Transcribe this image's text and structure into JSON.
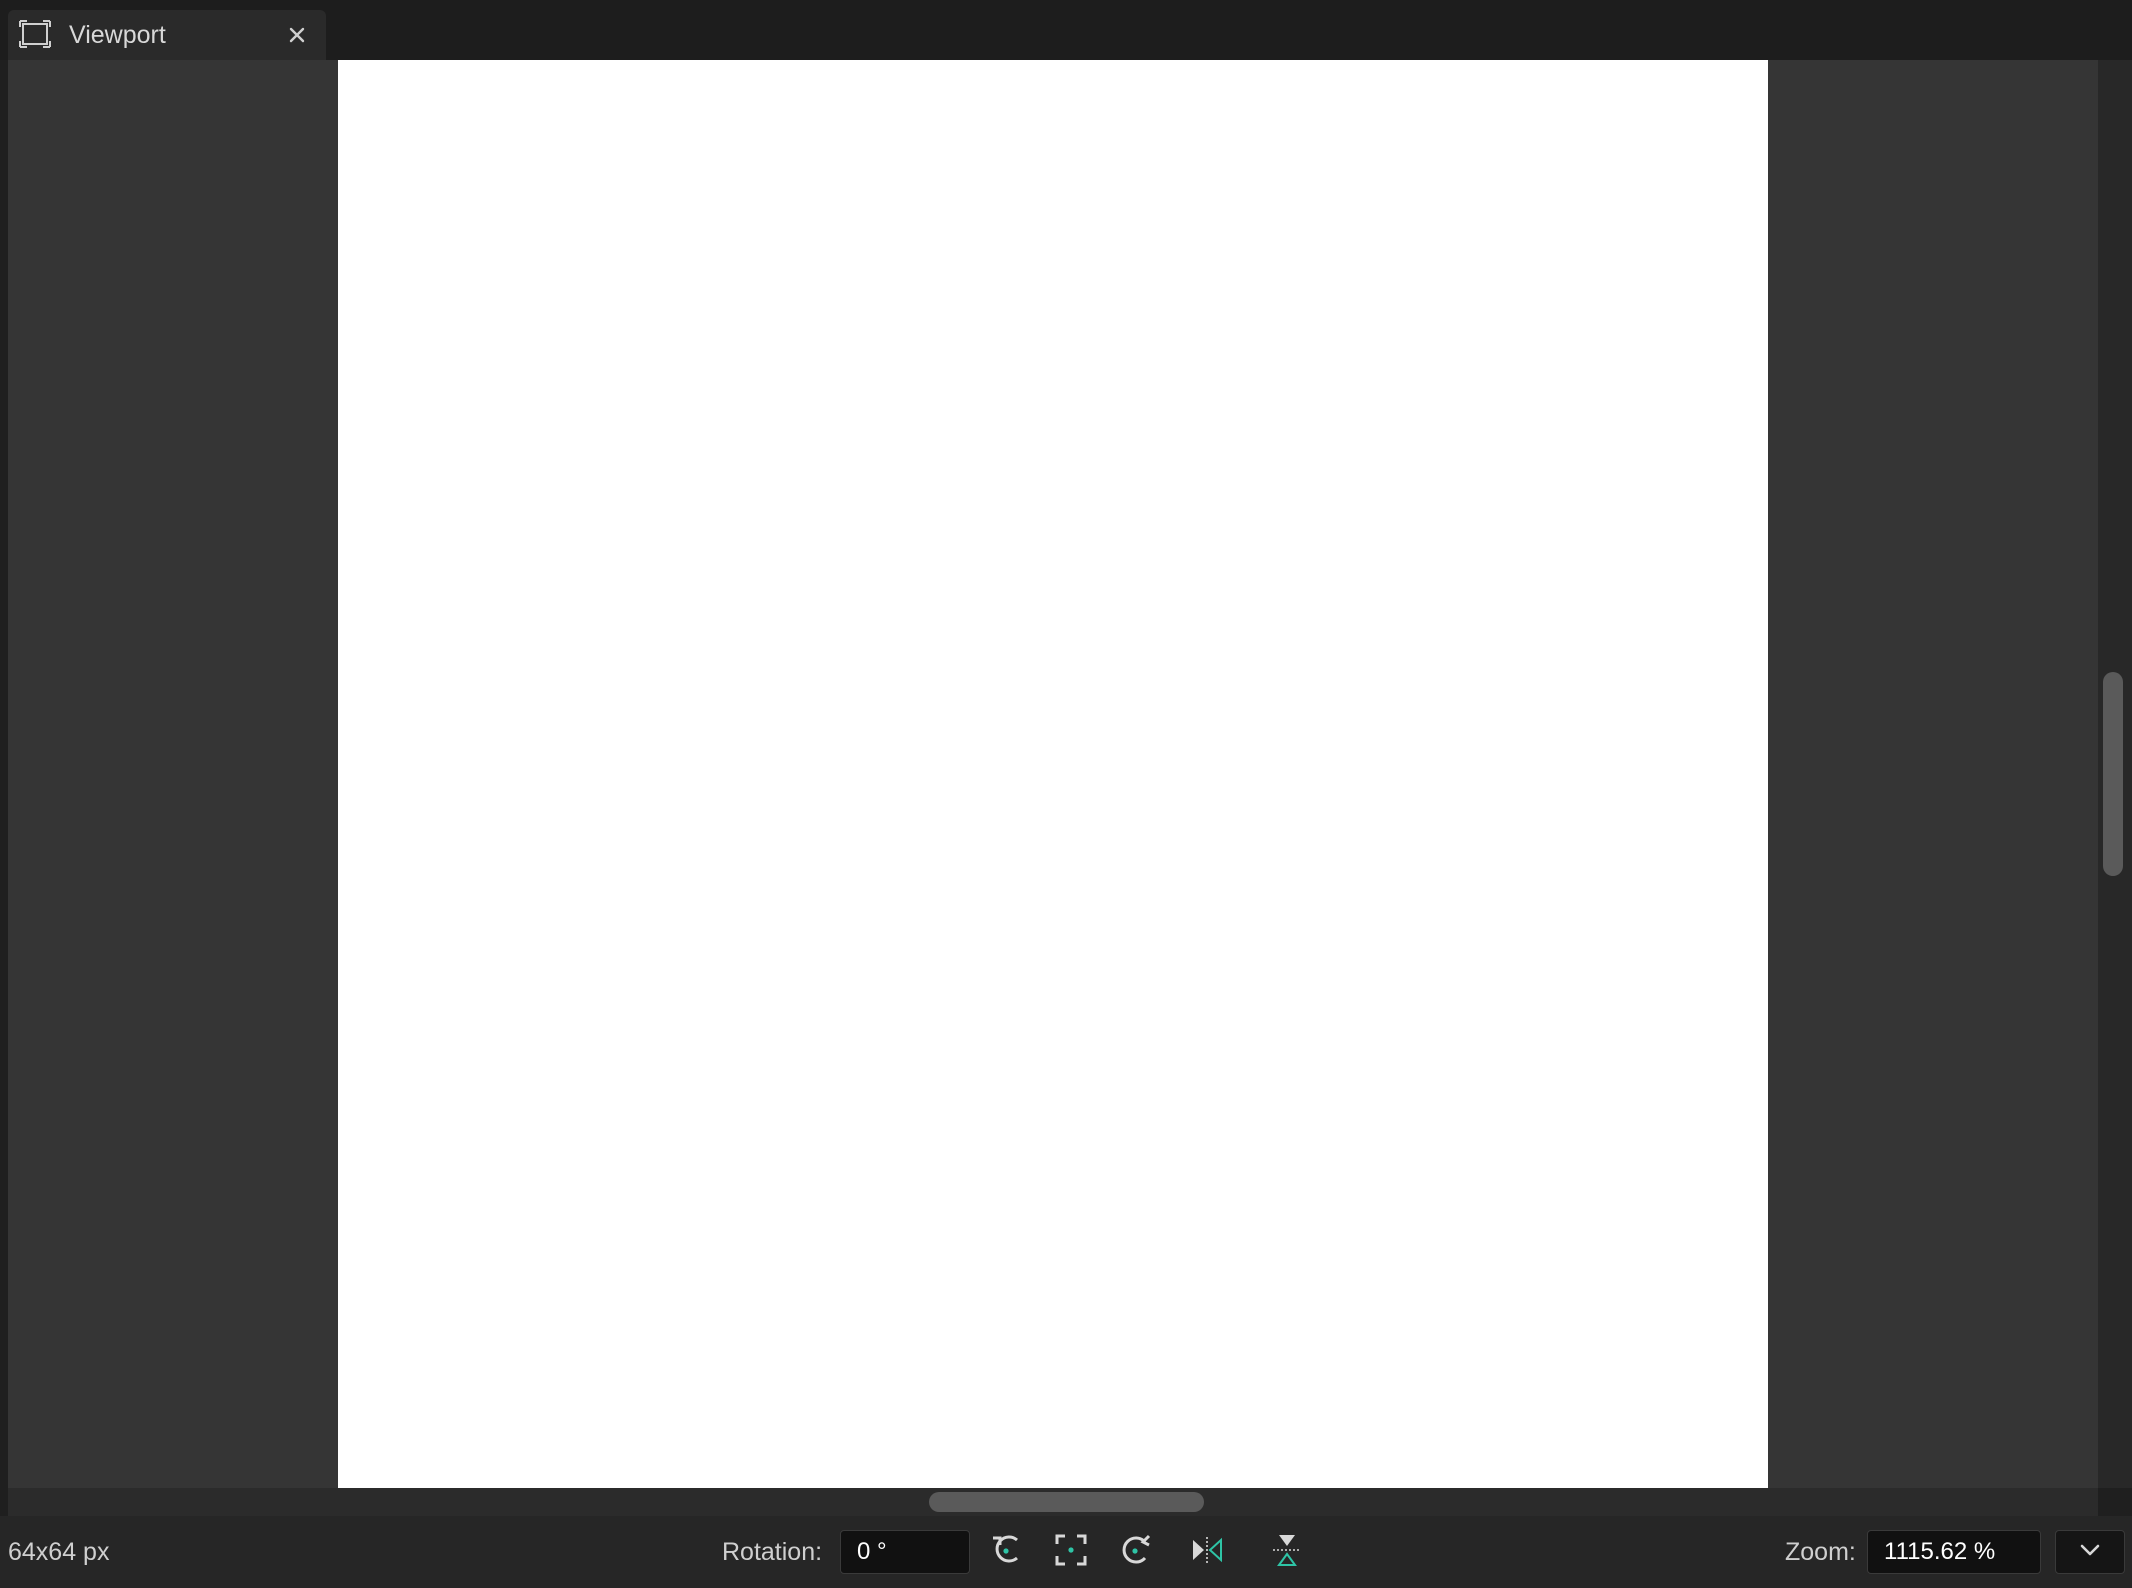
{
  "tab": {
    "title": "Viewport",
    "icon": "viewport-icon",
    "close_icon": "close-icon"
  },
  "status": {
    "image_size": "64x64 px",
    "rotation_label": "Rotation:",
    "rotation_value": "0 °",
    "zoom_label": "Zoom:",
    "zoom_value": "1115.62 %"
  },
  "tools": {
    "rotate_left": "rotate-left-icon",
    "fit": "fit-view-icon",
    "rotate_right": "rotate-right-icon",
    "flip_horizontal": "flip-horizontal-icon",
    "flip_vertical": "flip-vertical-icon"
  },
  "colors": {
    "accent": "#2ec4a6",
    "canvas": "#ffffff",
    "viewport_bg": "#353535"
  }
}
